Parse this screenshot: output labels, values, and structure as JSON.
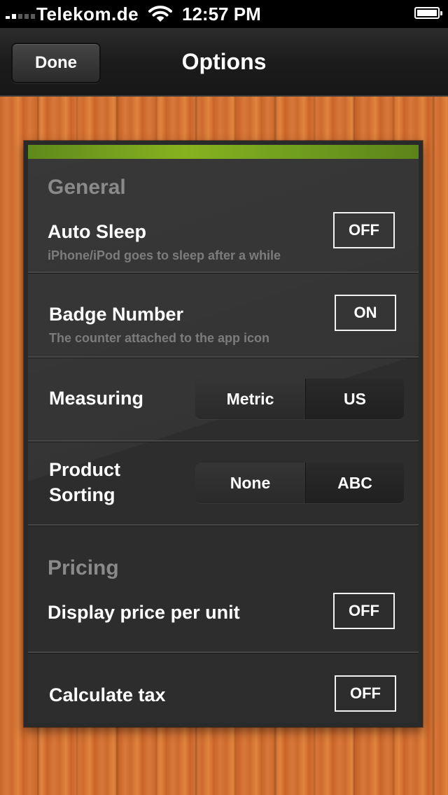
{
  "status_bar": {
    "carrier": "Telekom.de",
    "time": "12:57 PM",
    "signal_icon": "signal-bars-icon",
    "wifi_icon": "wifi-icon",
    "battery_icon": "battery-full-icon"
  },
  "nav": {
    "done_label": "Done",
    "title": "Options"
  },
  "colors": {
    "accent": "#7aa81f",
    "panel": "#2d2d2d",
    "wood": "#cf6d2f"
  },
  "general": {
    "section_title": "General",
    "auto_sleep": {
      "title": "Auto Sleep",
      "subtitle": "iPhone/iPod goes to sleep after a while",
      "value": "OFF"
    },
    "badge_number": {
      "title": "Badge Number",
      "subtitle": "The counter attached to the app icon",
      "value": "ON"
    },
    "measuring": {
      "title": "Measuring",
      "options": [
        "Metric",
        "US"
      ],
      "selected": "Metric"
    },
    "product_sorting": {
      "title_line1": "Product",
      "title_line2": "Sorting",
      "options": [
        "None",
        "ABC"
      ],
      "selected": "None"
    }
  },
  "pricing": {
    "section_title": "Pricing",
    "price_per_unit": {
      "title": "Display price per unit",
      "value": "OFF"
    },
    "calculate_tax": {
      "title": "Calculate tax",
      "value": "OFF"
    }
  }
}
